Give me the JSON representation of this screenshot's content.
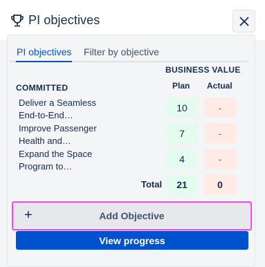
{
  "header": {
    "title": "PI objectives",
    "icon": "trophy-icon",
    "close_icon": "close-icon"
  },
  "tabs": [
    {
      "label": "PI objectives",
      "active": true
    },
    {
      "label": "Filter by objective",
      "active": false
    }
  ],
  "table": {
    "group_header": "BUSINESS VALUE",
    "section_label": "COMMITTED",
    "columns": {
      "plan": "Plan",
      "actual": "Actual"
    },
    "rows": [
      {
        "name_line1": "Deliver a Seamless",
        "name_line2": "End-to-End…",
        "plan": "10",
        "actual": "-"
      },
      {
        "name_line1": "Improve Passenger",
        "name_line2": "Health and…",
        "plan": "7",
        "actual": "-"
      },
      {
        "name_line1": "Expand the Space",
        "name_line2": "Program to…",
        "plan": "4",
        "actual": "-"
      }
    ],
    "total": {
      "label": "Total",
      "plan": "21",
      "actual": "0"
    }
  },
  "actions": {
    "add_icon": "+",
    "add_label": "Add Objective",
    "view_label": "View progress"
  },
  "colors": {
    "accent": "#0052cc",
    "plan_cell": "#e3fcef",
    "actual_cell": "#ffebe6",
    "highlight_outline": "#ff40ff"
  }
}
